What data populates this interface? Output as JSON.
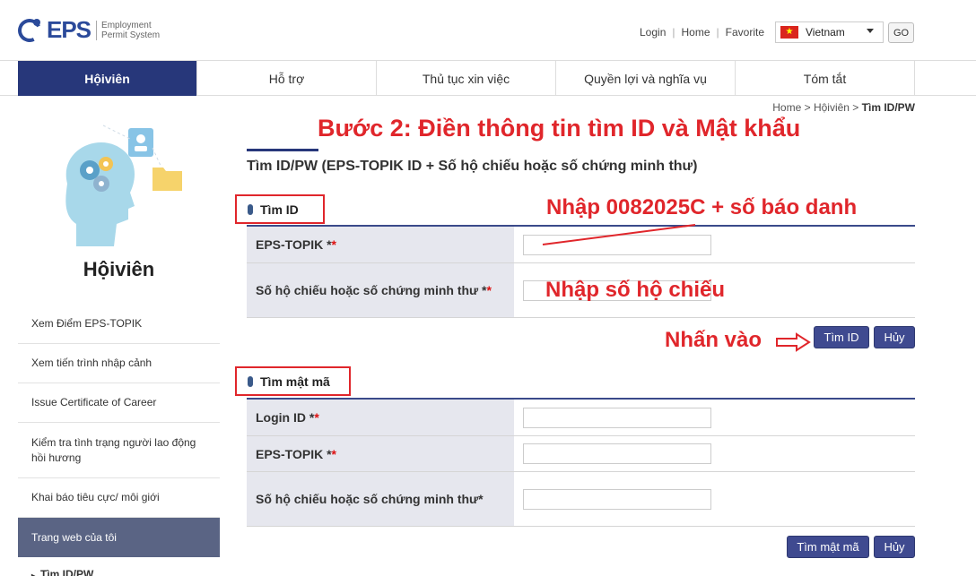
{
  "header": {
    "logo_text": "EPS",
    "logo_sub_line1": "Employment",
    "logo_sub_line2": "Permit System",
    "links": [
      "Login",
      "Home",
      "Favorite"
    ],
    "language": "Vietnam",
    "go_label": "GO"
  },
  "nav": {
    "items": [
      "Hộiviên",
      "Hỗ trợ",
      "Thủ tục xin việc",
      "Quyền lợi và nghĩa vụ",
      "Tóm tắt"
    ]
  },
  "sidebar": {
    "title": "Hộiviên",
    "items": [
      {
        "label": "Xem Điểm EPS-TOPIK"
      },
      {
        "label": "Xem tiến trình nhập cảnh"
      },
      {
        "label": "Issue Certificate of Career"
      },
      {
        "label": "Kiểm tra tình trạng người lao động hồi hương"
      },
      {
        "label": "Khai báo tiêu cực/ môi giới"
      },
      {
        "label": "Trang web của tôi"
      }
    ],
    "subitem": "Tìm ID/PW"
  },
  "breadcrumb": {
    "home": "Home",
    "section": "Hộiviên",
    "current": "Tìm ID/PW"
  },
  "annotations": {
    "step": "Bước 2: Điền thông tin tìm ID và Mật khẩu",
    "enter_topik": "Nhập 0082025C + số báo danh",
    "enter_passport": "Nhập số hộ chiếu",
    "click": "Nhấn vào"
  },
  "page_title": "Tìm ID/PW (EPS-TOPIK ID + Số hộ chiếu hoặc số chứng minh thư)",
  "find_id": {
    "heading": "Tìm ID",
    "fields": [
      {
        "label": "EPS-TOPIK *",
        "value": ""
      },
      {
        "label": "Số hộ chiếu hoặc số chứng minh thư *",
        "value": ""
      }
    ],
    "submit_label": "Tìm ID",
    "cancel_label": "Hủy"
  },
  "find_password": {
    "heading": "Tìm mật mã",
    "fields": [
      {
        "label": "Login ID *",
        "value": ""
      },
      {
        "label": "EPS-TOPIK *",
        "value": ""
      },
      {
        "label": "Số hộ chiếu hoặc số chứng minh thư*",
        "value": ""
      }
    ],
    "submit_label": "Tìm mật mã",
    "cancel_label": "Hủy"
  },
  "colors": {
    "brand": "#27377a",
    "annotation": "#e0262b",
    "button": "#3f4a90",
    "label_bg": "#e6e7ee"
  }
}
